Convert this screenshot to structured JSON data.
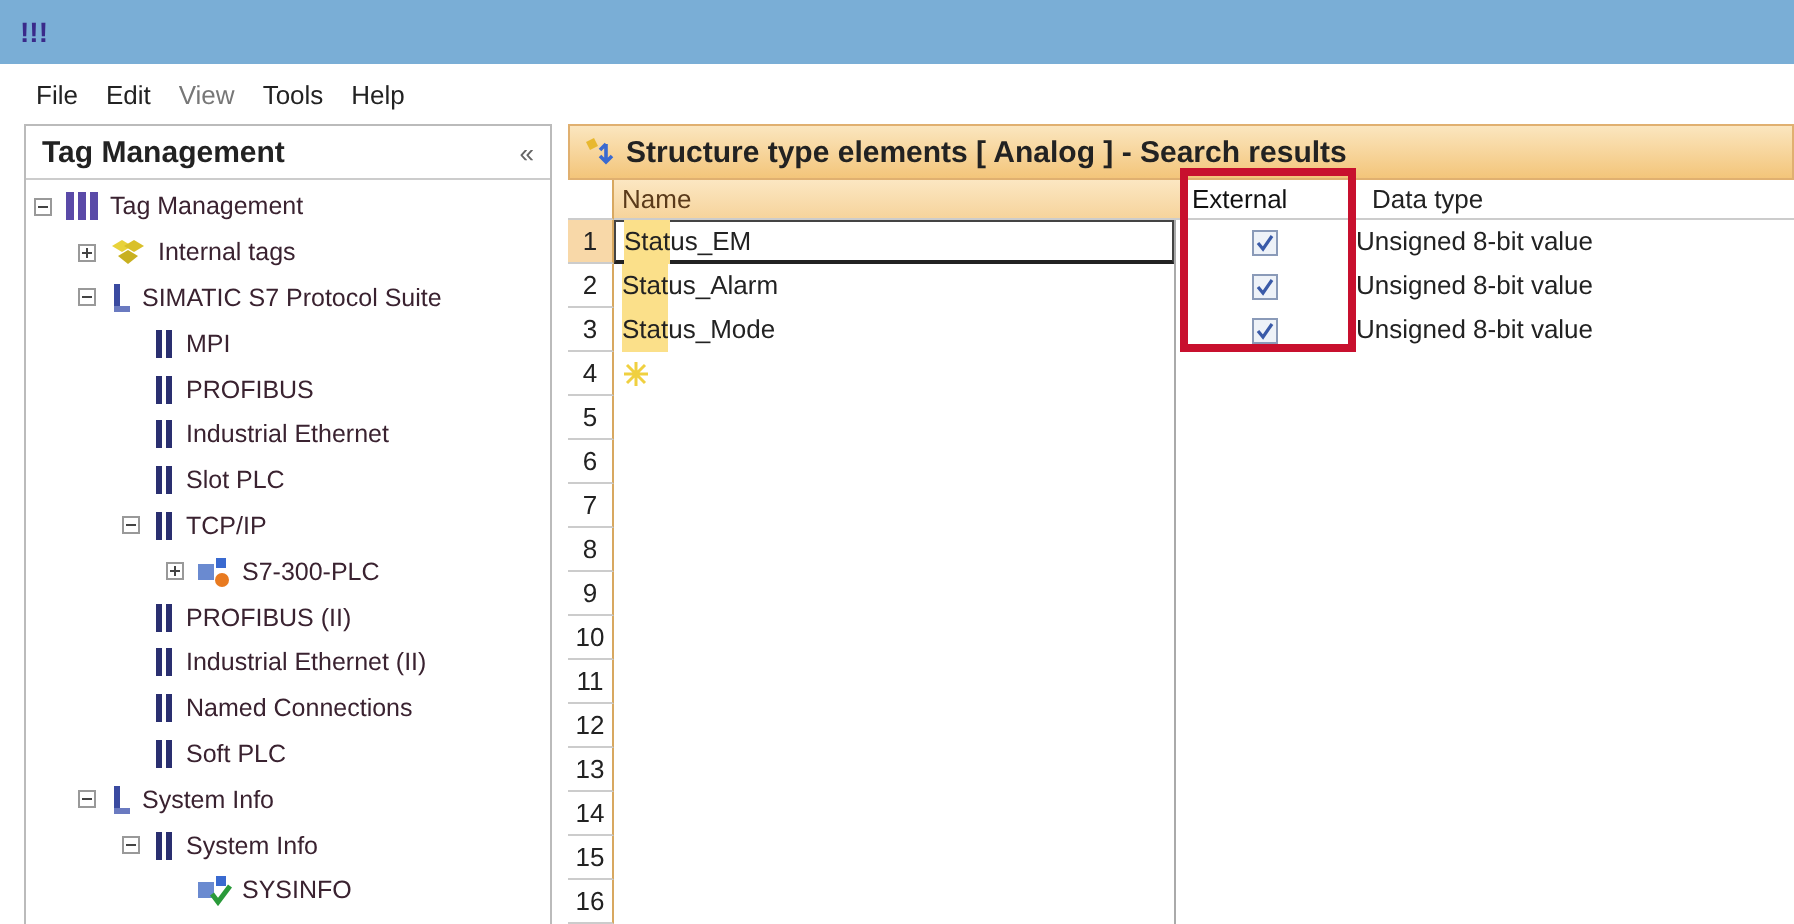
{
  "window": {
    "title": "!!!"
  },
  "menu": [
    {
      "label": "File",
      "disabled": false
    },
    {
      "label": "Edit",
      "disabled": false
    },
    {
      "label": "View",
      "disabled": true
    },
    {
      "label": "Tools",
      "disabled": false
    },
    {
      "label": "Help",
      "disabled": false
    }
  ],
  "sidebar": {
    "title": "Tag Management",
    "collapse": "«",
    "tree": [
      {
        "label": "Tag Management",
        "kind": "project",
        "expanded": true,
        "children": [
          {
            "label": "Internal tags",
            "kind": "tags",
            "expanded": false
          },
          {
            "label": "SIMATIC S7 Protocol Suite",
            "kind": "driver",
            "expanded": true,
            "children": [
              {
                "label": "MPI",
                "kind": "channel"
              },
              {
                "label": "PROFIBUS",
                "kind": "channel"
              },
              {
                "label": "Industrial Ethernet",
                "kind": "channel"
              },
              {
                "label": "Slot PLC",
                "kind": "channel"
              },
              {
                "label": "TCP/IP",
                "kind": "channel",
                "expanded": true,
                "children": [
                  {
                    "label": "S7-300-PLC",
                    "kind": "connection",
                    "expanded": false
                  }
                ]
              },
              {
                "label": "PROFIBUS (II)",
                "kind": "channel"
              },
              {
                "label": "Industrial Ethernet (II)",
                "kind": "channel"
              },
              {
                "label": "Named Connections",
                "kind": "channel"
              },
              {
                "label": "Soft PLC",
                "kind": "channel"
              }
            ]
          },
          {
            "label": "System Info",
            "kind": "driver",
            "expanded": true,
            "children": [
              {
                "label": "System Info",
                "kind": "channel",
                "expanded": true,
                "children": [
                  {
                    "label": "SYSINFO",
                    "kind": "sysinfo"
                  }
                ]
              }
            ]
          }
        ]
      }
    ]
  },
  "table": {
    "title": "Structure type elements [ Analog ] - Search results",
    "columns": [
      {
        "label": "Name",
        "highlighted": false
      },
      {
        "label": "External",
        "highlighted": true
      },
      {
        "label": "Data type",
        "highlighted": false
      }
    ],
    "rows": [
      {
        "number": "1",
        "kind": "item",
        "selected": true,
        "name_match": "Stat",
        "name_rest": "us_EM",
        "external": true,
        "data_type": "Unsigned 8-bit value"
      },
      {
        "number": "2",
        "kind": "item",
        "selected": false,
        "name_match": "Stat",
        "name_rest": "us_Alarm",
        "external": true,
        "data_type": "Unsigned 8-bit value"
      },
      {
        "number": "3",
        "kind": "item",
        "selected": false,
        "name_match": "Stat",
        "name_rest": "us_Mode",
        "external": true,
        "data_type": "Unsigned 8-bit value"
      },
      {
        "number": "4",
        "kind": "new",
        "selected": false
      },
      {
        "number": "5",
        "kind": "empty",
        "selected": false
      },
      {
        "number": "6",
        "kind": "empty",
        "selected": false
      },
      {
        "number": "7",
        "kind": "empty",
        "selected": false
      },
      {
        "number": "8",
        "kind": "empty",
        "selected": false
      },
      {
        "number": "9",
        "kind": "empty",
        "selected": false
      },
      {
        "number": "10",
        "kind": "empty",
        "selected": false
      },
      {
        "number": "11",
        "kind": "empty",
        "selected": false
      },
      {
        "number": "12",
        "kind": "empty",
        "selected": false
      },
      {
        "number": "13",
        "kind": "empty",
        "selected": false
      },
      {
        "number": "14",
        "kind": "empty",
        "selected": false
      },
      {
        "number": "15",
        "kind": "empty",
        "selected": false
      },
      {
        "number": "16",
        "kind": "empty",
        "selected": false
      }
    ]
  }
}
